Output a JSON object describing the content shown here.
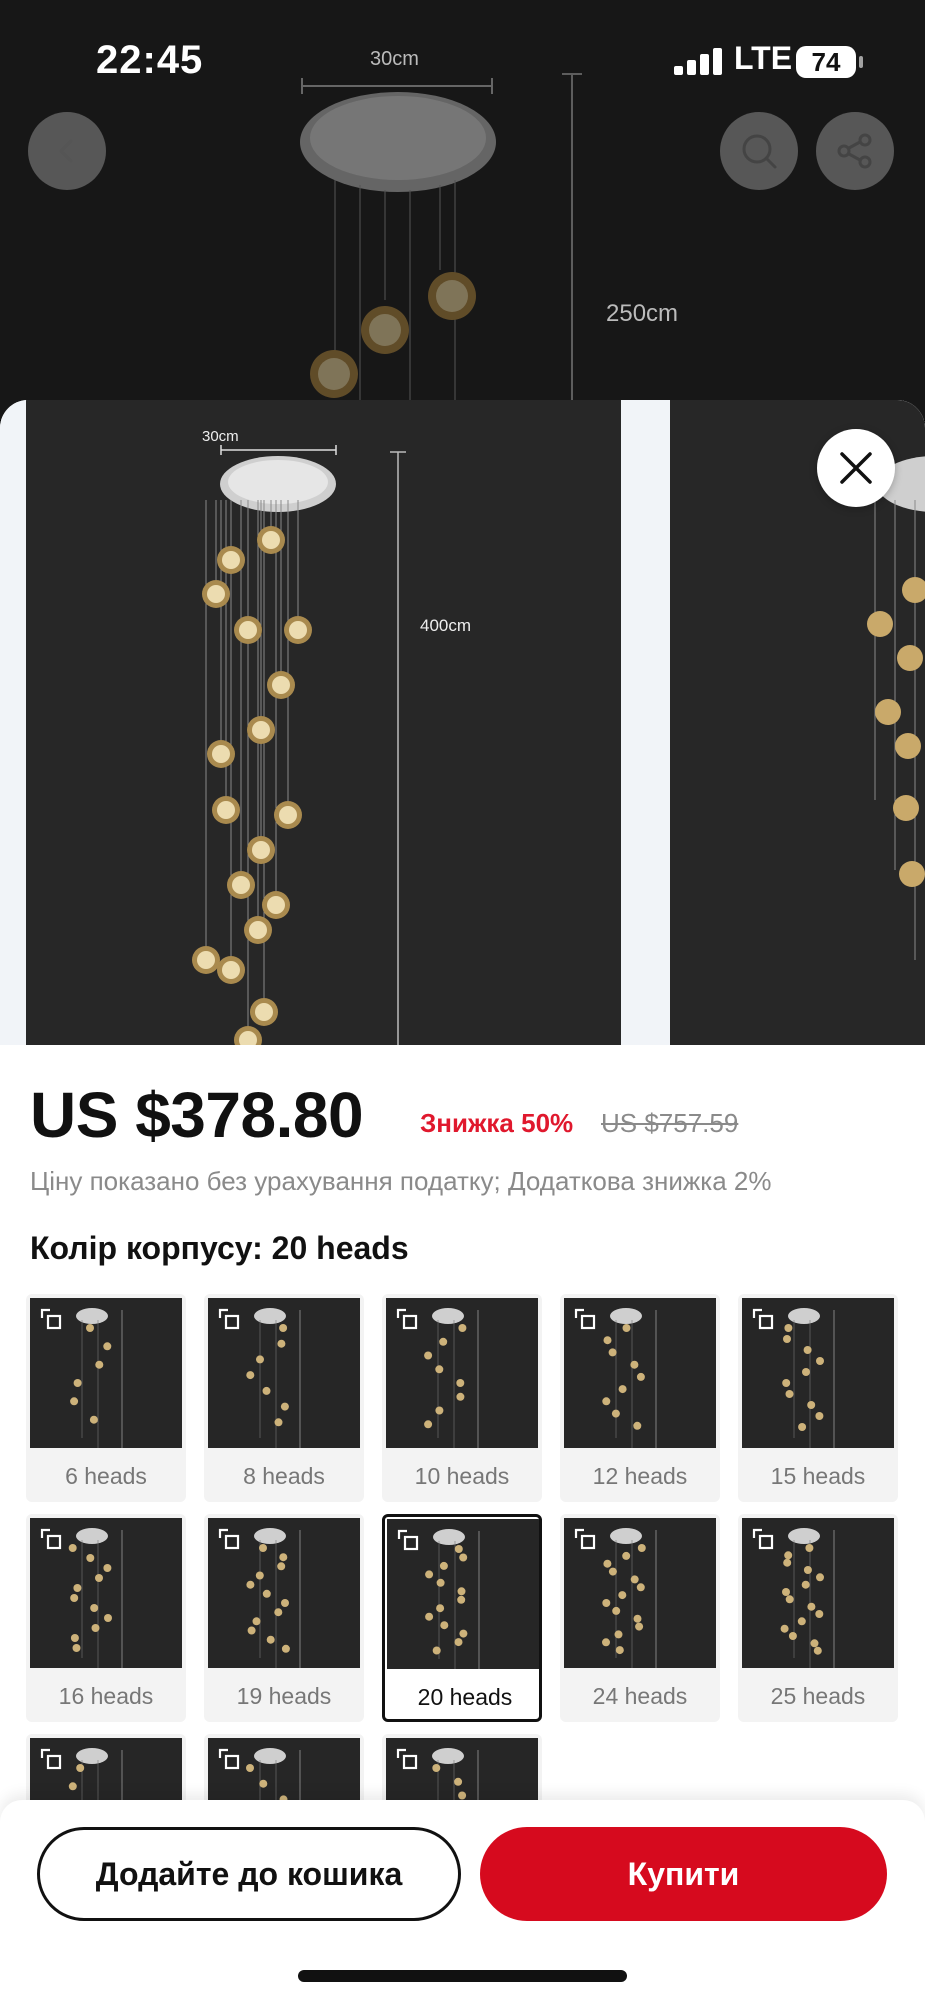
{
  "status_bar": {
    "time": "22:45",
    "network": "LTE",
    "battery": "74"
  },
  "background_image": {
    "width_label": "30cm",
    "height_label": "250cm"
  },
  "icons": {
    "back": "chevron-left-icon",
    "search": "search-icon",
    "share": "share-icon",
    "close": "close-icon",
    "expand": "expand-icon"
  },
  "gallery": {
    "main_width_label": "30cm",
    "main_height_label": "400cm"
  },
  "product": {
    "price": "US $378.80",
    "discount": "Знижка 50%",
    "old_price": "US $757.59",
    "tax_note": "Ціну показано без урахування податку; Додаткова знижка 2%",
    "color_title": "Колір корпусу: 20 heads"
  },
  "options": [
    {
      "label": "6 heads",
      "selected": false
    },
    {
      "label": "8 heads",
      "selected": false
    },
    {
      "label": "10 heads",
      "selected": false
    },
    {
      "label": "12 heads",
      "selected": false
    },
    {
      "label": "15 heads",
      "selected": false
    },
    {
      "label": "16 heads",
      "selected": false
    },
    {
      "label": "19 heads",
      "selected": false
    },
    {
      "label": "20 heads",
      "selected": true
    },
    {
      "label": "24 heads",
      "selected": false
    },
    {
      "label": "25 heads",
      "selected": false
    },
    {
      "label": "",
      "selected": false
    },
    {
      "label": "",
      "selected": false
    },
    {
      "label": "",
      "selected": false
    }
  ],
  "actions": {
    "add_to_cart": "Додайте до кошика",
    "buy": "Купити"
  },
  "colors": {
    "accent_red": "#d60a1e",
    "discount_red": "#e0182d",
    "product_bg": "#272727"
  }
}
